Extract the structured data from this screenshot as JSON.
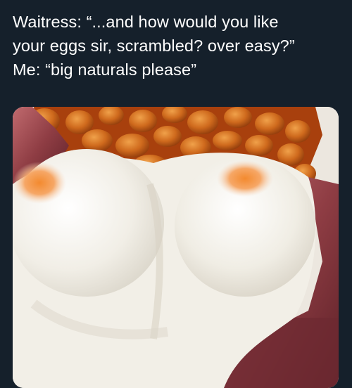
{
  "tweet": {
    "text_lines": [
      "Waitress: “...and how would you like",
      "your eggs sir, scrambled? over easy?”",
      "Me: “big naturals please”"
    ]
  },
  "media": {
    "subject": "food-photo",
    "colors": {
      "background": "#15202b",
      "text": "#ffffff",
      "beans": "#c7631a",
      "sauce": "#a8400d",
      "egg_white": "#f3f1ea",
      "yolk": "#f49a4a",
      "bacon": "#a5525a"
    }
  }
}
